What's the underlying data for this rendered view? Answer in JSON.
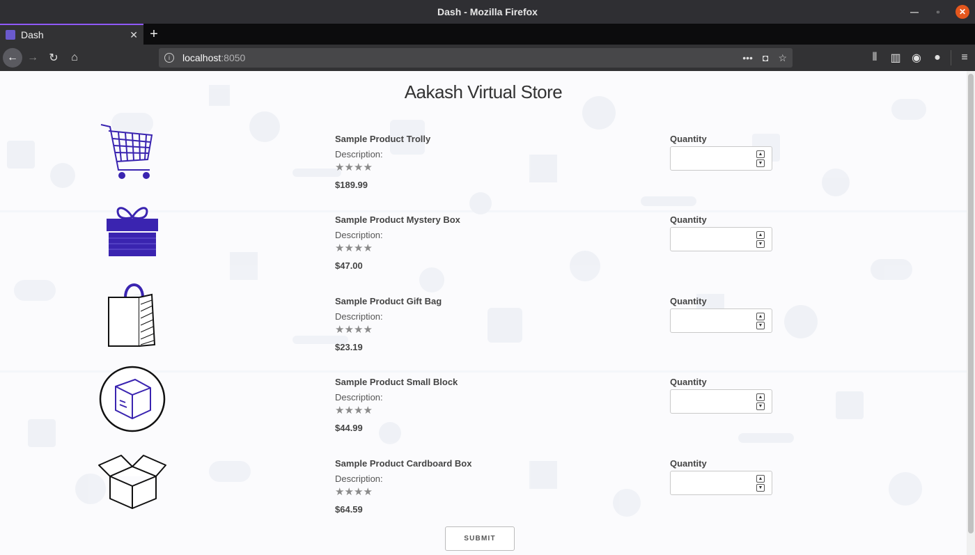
{
  "window": {
    "title": "Dash - Mozilla Firefox"
  },
  "tab": {
    "title": "Dash"
  },
  "url": {
    "host": "localhost",
    "port": ":8050"
  },
  "store": {
    "title": "Aakash Virtual Store",
    "submit_label": "SUBMIT"
  },
  "products": [
    {
      "name": "Sample Product Trolly",
      "description": "Description:",
      "price": "$189.99",
      "rating": 4,
      "quantity_label": "Quantity",
      "quantity_value": "",
      "icon": "shopping-cart-icon"
    },
    {
      "name": "Sample Product Mystery Box",
      "description": "Description:",
      "price": "$47.00",
      "rating": 4,
      "quantity_label": "Quantity",
      "quantity_value": "",
      "icon": "gift-box-icon"
    },
    {
      "name": "Sample Product Gift Bag",
      "description": "Description:",
      "price": "$23.19",
      "rating": 4,
      "quantity_label": "Quantity",
      "quantity_value": "",
      "icon": "gift-bag-icon"
    },
    {
      "name": "Sample Product Small Block",
      "description": "Description:",
      "price": "$44.99",
      "rating": 4,
      "quantity_label": "Quantity",
      "quantity_value": "",
      "icon": "cube-block-icon"
    },
    {
      "name": "Sample Product Cardboard Box",
      "description": "Description:",
      "price": "$64.59",
      "rating": 4,
      "quantity_label": "Quantity",
      "quantity_value": "",
      "icon": "cardboard-box-icon"
    }
  ],
  "colors": {
    "accent": "#3a24b0",
    "tab_highlight": "#9059ff",
    "page_bg": "#fbfbfd"
  }
}
